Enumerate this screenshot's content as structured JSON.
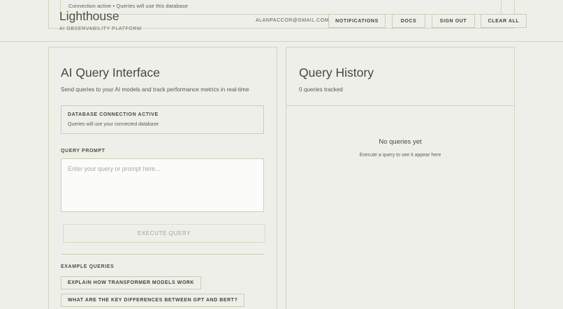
{
  "banner": {
    "text": "Connection active • Queries will use this database"
  },
  "header": {
    "brand": "Lighthouse",
    "tagline": "AI OBSERVABILITY PLATFORM",
    "email": "ALANPACCOR@GMAIL.COM",
    "buttons": {
      "notifications": "NOTIFICATIONS",
      "docs": "DOCS",
      "sign_out": "SIGN OUT",
      "clear_all": "CLEAR ALL"
    }
  },
  "query_panel": {
    "title": "AI Query Interface",
    "subtitle": "Send queries to your AI models and track performance metrics in real-time",
    "db_status": {
      "title": "DATABASE CONNECTION ACTIVE",
      "detail": "Queries will use your connected database"
    },
    "prompt_label": "QUERY PROMPT",
    "prompt_placeholder": "Enter your query or prompt here...",
    "prompt_value": "",
    "execute_label": "EXECUTE QUERY",
    "examples_label": "EXAMPLE QUERIES",
    "examples": [
      "EXPLAIN HOW TRANSFORMER MODELS WORK",
      "WHAT ARE THE KEY DIFFERENCES BETWEEN GPT AND BERT?"
    ]
  },
  "history_panel": {
    "title": "Query History",
    "count_text": "0 queries tracked",
    "empty_title": "No queries yet",
    "empty_subtitle": "Execute a query to see it appear here"
  },
  "colors": {
    "background": "#efefea",
    "border": "#cdd6bd",
    "text": "#44493b",
    "input_bg": "#fbfbf9"
  }
}
